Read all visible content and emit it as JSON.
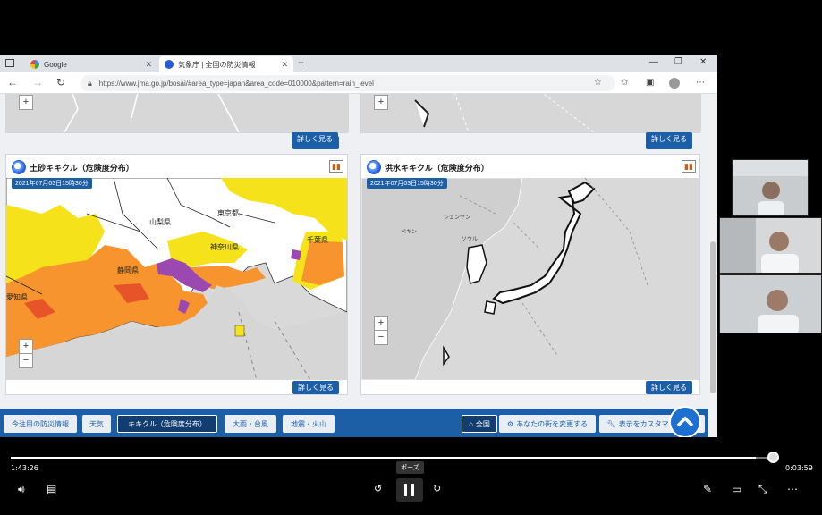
{
  "browser": {
    "tabs": [
      {
        "title": "Google",
        "active": false
      },
      {
        "title": "気象庁 | 全国の防災情報",
        "active": true
      }
    ],
    "url": "https://www.jma.go.jp/bosai/#area_type=japan&area_code=010000&pattern=rain_level"
  },
  "panels": {
    "detail_label": "詳しく見る",
    "left": {
      "title": "土砂キキクル（危険度分布）",
      "timestamp": "2021年07月03日15時30分"
    },
    "right": {
      "title": "洪水キキクル（危険度分布）",
      "timestamp": "2021年07月03日15時30分"
    },
    "map_labels": {
      "yamanashi": "山梨県",
      "tokyo": "東京都",
      "kanagawa": "神奈川県",
      "chiba": "千葉県",
      "shizuoka": "静岡県",
      "aichi": "愛知県",
      "shenyang": "シェンヤン",
      "beijing": "ペキン",
      "seoul": "ソウル"
    }
  },
  "bottom_nav": {
    "items": [
      "今注目の防災情報",
      "天気",
      "キキクル（危険度分布）",
      "大雨・台風",
      "地震・火山"
    ],
    "selected_index": 2,
    "right_items": [
      "全国",
      "あなたの街を変更する",
      "表示をカスタマイズする"
    ]
  },
  "player": {
    "current_time": "1:43:26",
    "remaining_time": "0:03:59",
    "progress_fraction": 0.98,
    "tooltip": "ポーズ"
  },
  "colors": {
    "accent": "#1d5fa7",
    "risk_yellow": "#f5e21a",
    "risk_orange": "#f7942e",
    "risk_red": "#e8542a",
    "risk_purple": "#9b49b0"
  }
}
